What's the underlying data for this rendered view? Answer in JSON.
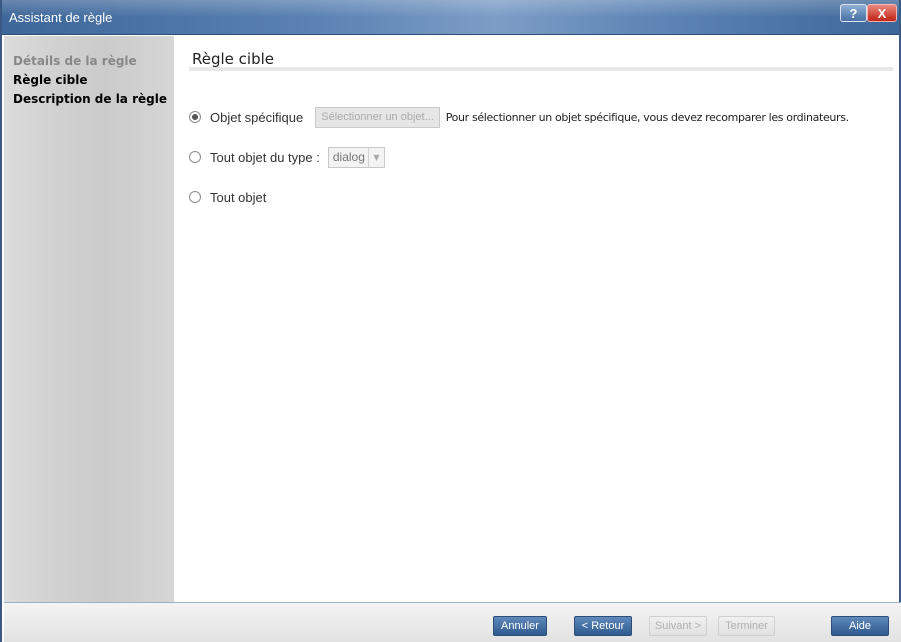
{
  "window": {
    "title": "Assistant de règle",
    "help_label": "?",
    "close_label": "X"
  },
  "sidebar": {
    "items": [
      {
        "label": "Détails de la règle",
        "state": "visited"
      },
      {
        "label": "Règle cible",
        "state": "active"
      },
      {
        "label": "Description de la règle",
        "state": "active"
      }
    ]
  },
  "main": {
    "title": "Règle cible",
    "options": [
      {
        "label": "Objet spécifique",
        "checked": true,
        "button_label": "Sélectionner un objet...",
        "button_enabled": false,
        "hint": "Pour sélectionner un objet spécifique, vous devez recomparer les ordinateurs."
      },
      {
        "label": "Tout objet du type :",
        "checked": false,
        "select_value": "dialog",
        "select_enabled": false
      },
      {
        "label": "Tout objet",
        "checked": false
      }
    ]
  },
  "footer": {
    "buttons": [
      {
        "label": "Annuler",
        "enabled": true
      },
      {
        "label": "< Retour",
        "enabled": true
      },
      {
        "label": "Suivant >",
        "enabled": false
      },
      {
        "label": "Terminer",
        "enabled": false
      },
      {
        "label": "Aide",
        "enabled": true
      }
    ]
  },
  "colors": {
    "titlebar": "#4f77a8",
    "primary_button": "#3f6a9e",
    "close_button": "#d0392b"
  }
}
